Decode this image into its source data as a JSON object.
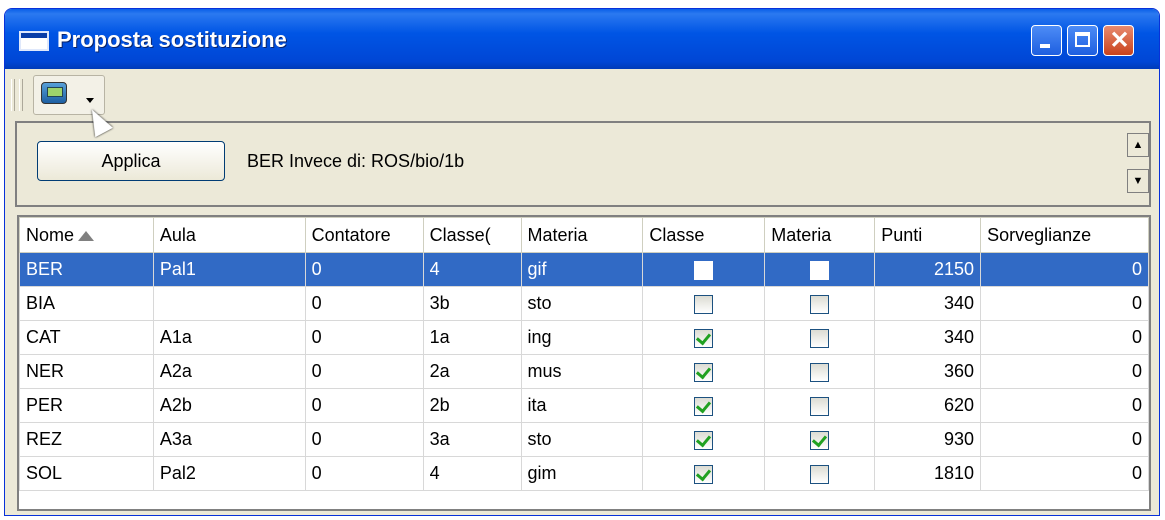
{
  "window": {
    "title": "Proposta sostituzione",
    "close_symbol": "✕"
  },
  "toolbar": {
    "tool_icon": "teacher-icon"
  },
  "panel": {
    "apply_label": "Applica",
    "status_text": "BER Invece di: ROS/bio/1b",
    "scroll_up_symbol": "▲",
    "scroll_down_symbol": "▼"
  },
  "grid": {
    "columns": [
      "Nome",
      "Aula",
      "Contatore",
      "Classe(",
      "Materia",
      "Classe",
      "Materia",
      "Punti",
      "Sorveglianze"
    ],
    "sort_column": "Nome",
    "rows": [
      {
        "nome": "BER",
        "aula": "Pal1",
        "contatore": "0",
        "classe_short": "4",
        "materia": "gif",
        "classe_chk": false,
        "materia_chk": false,
        "punti": "2150",
        "sorveglianze": "0",
        "selected": true
      },
      {
        "nome": "BIA",
        "aula": "",
        "contatore": "0",
        "classe_short": "3b",
        "materia": "sto",
        "classe_chk": false,
        "materia_chk": false,
        "punti": "340",
        "sorveglianze": "0",
        "selected": false
      },
      {
        "nome": "CAT",
        "aula": "A1a",
        "contatore": "0",
        "classe_short": "1a",
        "materia": "ing",
        "classe_chk": true,
        "materia_chk": false,
        "punti": "340",
        "sorveglianze": "0",
        "selected": false
      },
      {
        "nome": "NER",
        "aula": "A2a",
        "contatore": "0",
        "classe_short": "2a",
        "materia": "mus",
        "classe_chk": true,
        "materia_chk": false,
        "punti": "360",
        "sorveglianze": "0",
        "selected": false
      },
      {
        "nome": "PER",
        "aula": "A2b",
        "contatore": "0",
        "classe_short": "2b",
        "materia": "ita",
        "classe_chk": true,
        "materia_chk": false,
        "punti": "620",
        "sorveglianze": "0",
        "selected": false
      },
      {
        "nome": "REZ",
        "aula": "A3a",
        "contatore": "0",
        "classe_short": "3a",
        "materia": "sto",
        "classe_chk": true,
        "materia_chk": true,
        "punti": "930",
        "sorveglianze": "0",
        "selected": false
      },
      {
        "nome": "SOL",
        "aula": "Pal2",
        "contatore": "0",
        "classe_short": "4",
        "materia": "gim",
        "classe_chk": true,
        "materia_chk": false,
        "punti": "1810",
        "sorveglianze": "0",
        "selected": false
      }
    ]
  }
}
